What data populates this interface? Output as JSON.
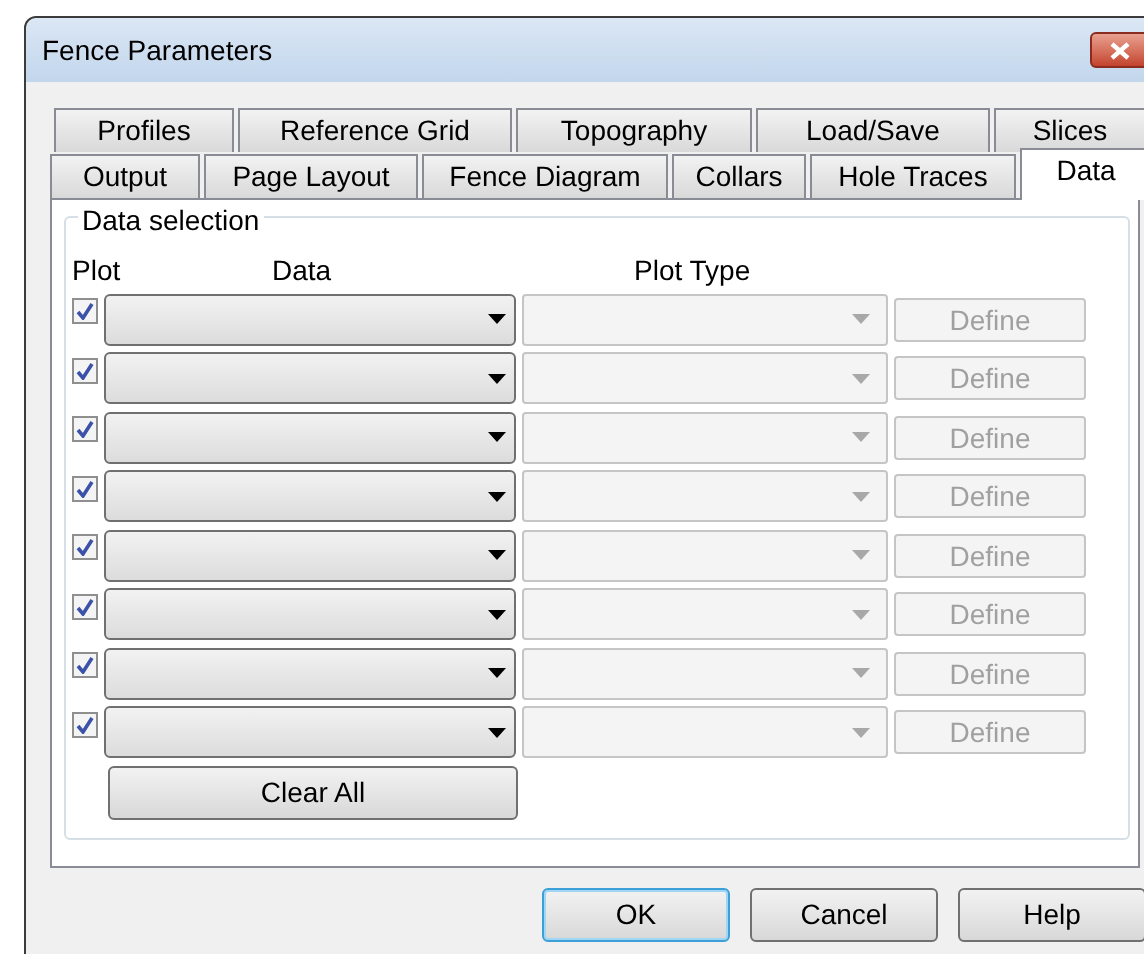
{
  "window": {
    "title": "Fence Parameters"
  },
  "tab_rows": [
    [
      {
        "label": "Profiles",
        "selected": false
      },
      {
        "label": "Reference Grid",
        "selected": false
      },
      {
        "label": "Topography",
        "selected": false
      },
      {
        "label": "Load/Save",
        "selected": false
      },
      {
        "label": "Slices",
        "selected": false
      }
    ],
    [
      {
        "label": "Output",
        "selected": false
      },
      {
        "label": "Page Layout",
        "selected": false
      },
      {
        "label": "Fence Diagram",
        "selected": false
      },
      {
        "label": "Collars",
        "selected": false
      },
      {
        "label": "Hole Traces",
        "selected": false
      },
      {
        "label": "Data",
        "selected": true
      }
    ]
  ],
  "group": {
    "title": "Data selection",
    "columns": [
      "Plot",
      "Data",
      "Plot Type"
    ],
    "rows": [
      {
        "checked": true,
        "define": "Define",
        "disabled": true
      },
      {
        "checked": true,
        "define": "Define",
        "disabled": true
      },
      {
        "checked": true,
        "define": "Define",
        "disabled": true
      },
      {
        "checked": true,
        "define": "Define",
        "disabled": true
      },
      {
        "checked": true,
        "define": "Define",
        "disabled": true
      },
      {
        "checked": true,
        "define": "Define",
        "disabled": true
      },
      {
        "checked": true,
        "define": "Define",
        "disabled": true
      },
      {
        "checked": true,
        "define": "Define",
        "disabled": true
      }
    ],
    "clear_button": "Clear All"
  },
  "buttons": [
    {
      "label": "OK",
      "default": true
    },
    {
      "label": "Cancel",
      "default": false
    },
    {
      "label": "Help",
      "default": false
    }
  ]
}
